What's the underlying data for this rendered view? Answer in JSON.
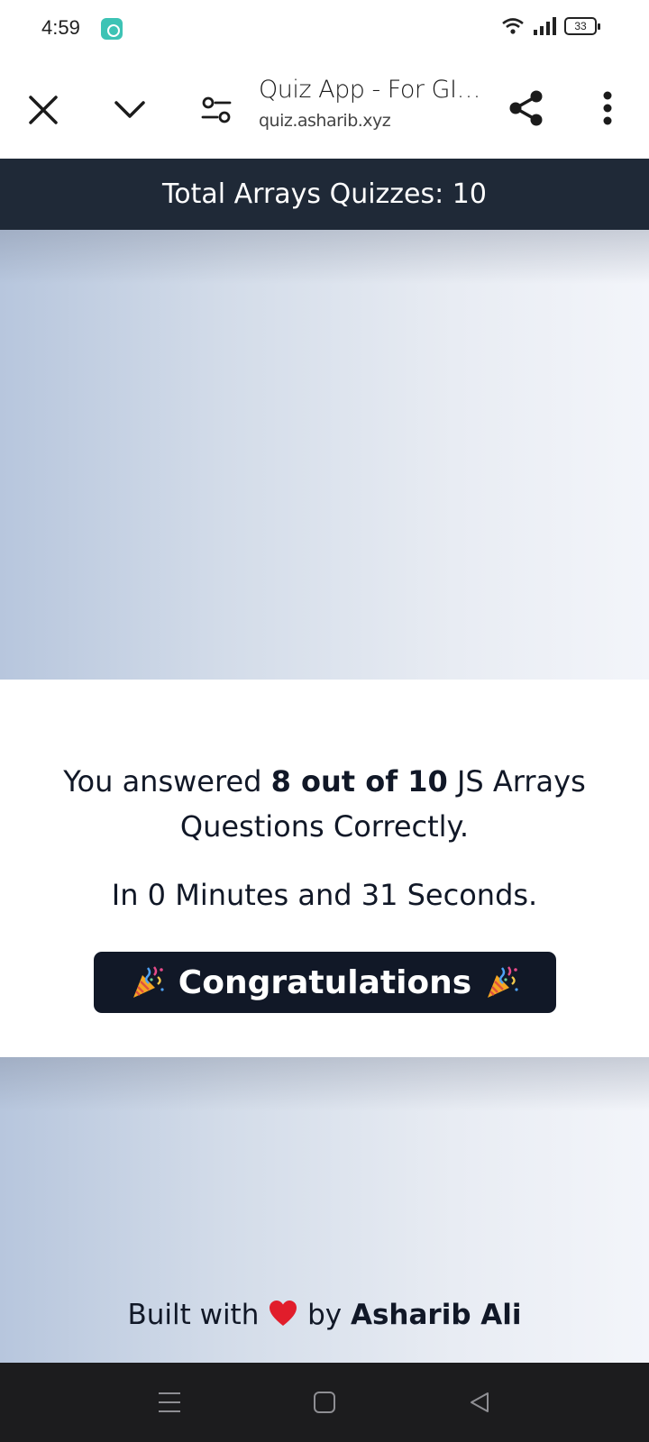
{
  "status_bar": {
    "time": "4:59",
    "battery": "33"
  },
  "browser": {
    "page_title": "Quiz App - For GIAI...",
    "url": "quiz.asharib.xyz"
  },
  "header": {
    "title": "Total Arrays Quizzes: 10"
  },
  "result": {
    "prefix": "You answered ",
    "score": "8 out of 10",
    "suffix": " JS Arrays Questions Correctly.",
    "time": "In 0 Minutes and 31 Seconds.",
    "congrats_label": "Congratulations"
  },
  "footer": {
    "built_with": "Built with",
    "by": "by",
    "author": "Asharib Ali"
  },
  "colors": {
    "header_bg": "#1f2937",
    "button_bg": "#111827",
    "accent_teal": "#3dc3b5",
    "heart": "#e11d2b"
  }
}
